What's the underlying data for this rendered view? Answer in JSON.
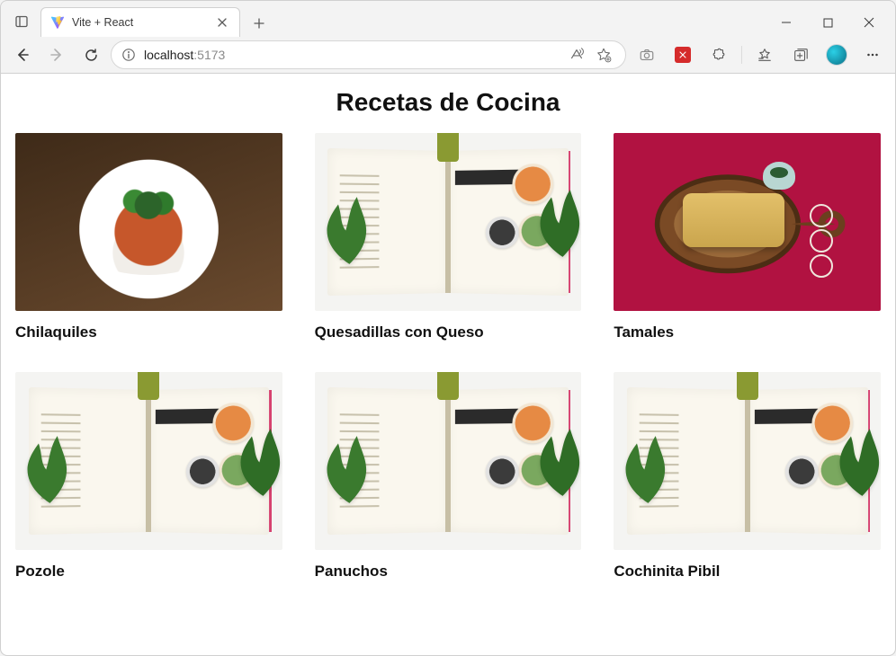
{
  "browser": {
    "tab_title": "Vite + React",
    "url_host": "localhost",
    "url_port": ":5173"
  },
  "page": {
    "title": "Recetas de Cocina",
    "recipes": [
      {
        "name": "Chilaquiles",
        "art": "chilaquiles"
      },
      {
        "name": "Quesadillas con Queso",
        "art": "cookbook"
      },
      {
        "name": "Tamales",
        "art": "tamales"
      },
      {
        "name": "Pozole",
        "art": "cookbook"
      },
      {
        "name": "Panuchos",
        "art": "cookbook"
      },
      {
        "name": "Cochinita Pibil",
        "art": "cookbook"
      }
    ]
  }
}
